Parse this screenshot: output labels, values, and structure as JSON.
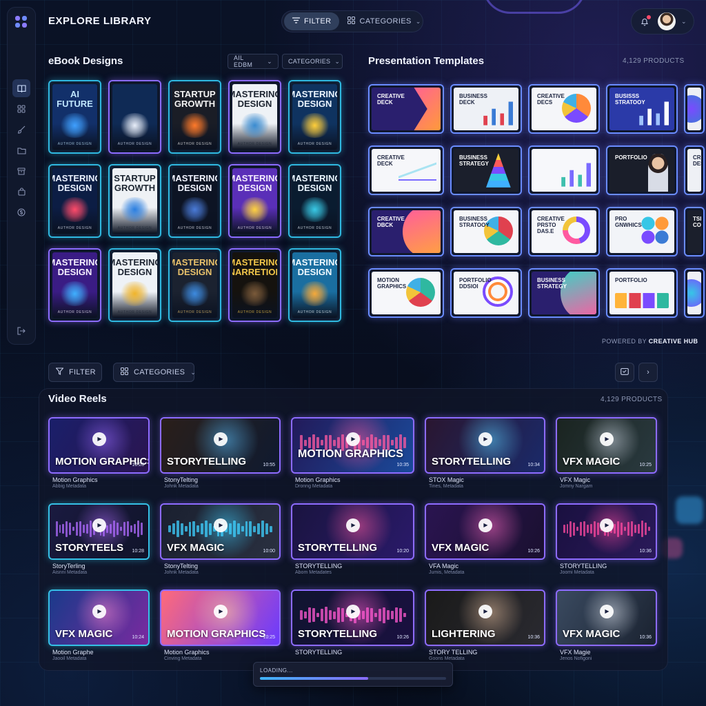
{
  "header": {
    "title": "EXPLORE LIBRARY",
    "filter_label": "FILTER",
    "categories_label": "CATEGORIES"
  },
  "ebooks": {
    "title": "eBook Designs",
    "filter_all": "AIL EDBM",
    "filter_categories": "CATEGORIES",
    "items": [
      {
        "title": "AI FUTURE",
        "author": "AUTHOR DESIGN",
        "bg": "#12306a",
        "fg": "#bfe6ff",
        "art": "#3fa0ff",
        "frame": "cyan"
      },
      {
        "title": "",
        "author": "AUTHOR DESIGN",
        "bg": "#0f2a55",
        "fg": "#dbe8ff",
        "art": "#e8eef9",
        "frame": "purple"
      },
      {
        "title": "STARTUP GROWTH",
        "author": "AUTHOR DESIGN",
        "bg": "#1a1d26",
        "fg": "#f3f3f3",
        "art": "#ff7a2a",
        "frame": "cyan"
      },
      {
        "title": "MASTERING DESIGN",
        "author": "AUTHOR DESIGN",
        "bg": "#eef2f6",
        "fg": "#1c2430",
        "art": "#3a8bd0",
        "frame": "purple"
      },
      {
        "title": "MASTERING DESIGN",
        "author": "AUTHOR DESIGN",
        "bg": "#0f3360",
        "fg": "#eaf4ff",
        "art": "#ffce3a",
        "frame": "cyan"
      },
      {
        "title": "MASTERING DESIGN",
        "author": "AUTHOR DESIGN",
        "bg": "#0c1d44",
        "fg": "#eaf0ff",
        "art": "#ff4b6a",
        "frame": "cyan"
      },
      {
        "title": "STARTUP GROWTH",
        "author": "AUTHOR DESIGN",
        "bg": "#eef1f5",
        "fg": "#1b2430",
        "art": "#2a7ee0",
        "frame": "cyan"
      },
      {
        "title": "MASTERING DESIGN",
        "author": "AUTHOR DESIGN",
        "bg": "#0d1424",
        "fg": "#f2f4ff",
        "art": "#4a7bd8",
        "frame": "cyan"
      },
      {
        "title": "MASTERING DESIGN",
        "author": "AUTHOR DESIGN",
        "bg": "#5a2fb8",
        "fg": "#f4ecff",
        "art": "#ffd23f",
        "frame": "purple"
      },
      {
        "title": "MASTERING DESIGN",
        "author": "AUTHOR DESIGN",
        "bg": "#0a1c30",
        "fg": "#eaf6ff",
        "art": "#39c9e6",
        "frame": "cyan"
      },
      {
        "title": "MASTERING DESIGN",
        "author": "AUTHOR DESIGN",
        "bg": "#3a1c84",
        "fg": "#f5efff",
        "art": "#3fb0ff",
        "frame": "purple"
      },
      {
        "title": "MASTERING DESIGN",
        "author": "AUTHOR DESIGN",
        "bg": "#eef2f7",
        "fg": "#1e2532",
        "art": "#f0b42a",
        "frame": "cyan"
      },
      {
        "title": "MASTERING DESIGN",
        "author": "AUTHOR DESIGN",
        "bg": "#1b2230",
        "fg": "#e8c16b",
        "art": "#3d8be0",
        "frame": "cyan"
      },
      {
        "title": "MASTERING GNARRETIORS",
        "author": "AUTHOR DESIGN",
        "bg": "#15120e",
        "fg": "#f2c64a",
        "art": "#7a5a3a",
        "frame": "purple"
      },
      {
        "title": "MASTERING DESIGN",
        "author": "AUTHOR DESIGN",
        "bg": "#1a6ea0",
        "fg": "#eef9ff",
        "art": "#f6a93a",
        "frame": "cyan"
      }
    ]
  },
  "presentations": {
    "title": "Presentation Templates",
    "count": "4,129 PRODUCTS",
    "items": [
      {
        "label": "CREATIVE DECK",
        "bg": "#2a1f6e",
        "fg": "#ffffff",
        "shape": "chevron",
        "c1": "#ff5aa0",
        "c2": "#ff9a3a"
      },
      {
        "label": "BUSINESS DECK",
        "bg": "#eef1f6",
        "fg": "#1d2540",
        "shape": "bars",
        "c1": "#e0414f",
        "c2": "#3a7bd5"
      },
      {
        "label": "CREATIVE DECS",
        "bg": "#f5f6f9",
        "fg": "#1d2540",
        "shape": "pie",
        "c1": "#ff8a3a",
        "c2": "#7a4bff"
      },
      {
        "label": "BUSISSS STRATOOY",
        "bg": "#2b3aa8",
        "fg": "#ffffff",
        "shape": "bars",
        "c1": "#9fc2ff",
        "c2": "#ffffff"
      },
      {
        "label": "",
        "bg": "#eef0f5",
        "fg": "#1d2540",
        "shape": "circle",
        "c1": "#7a4bff",
        "c2": "#3a7bd5"
      },
      {
        "label": "CREATIVE DECK",
        "bg": "#f6f7fa",
        "fg": "#1d2540",
        "shape": "line",
        "c1": "#7a6bff",
        "c2": "#36c6e6"
      },
      {
        "label": "BUSINESS STRATEGY",
        "bg": "#1b1f2c",
        "fg": "#ffffff",
        "shape": "pyramid",
        "c1": "#ff5a5a",
        "c2": "#3fb0ff"
      },
      {
        "label": "",
        "bg": "#f7f8fb",
        "fg": "#1d2540",
        "shape": "bars",
        "c1": "#3fbfae",
        "c2": "#7a6bff"
      },
      {
        "label": "PORTFOLIO",
        "bg": "#1a1e2a",
        "fg": "#ffffff",
        "shape": "person",
        "c1": "#e9c3a3",
        "c2": "#3a5bd5"
      },
      {
        "label": "CREA DESIG",
        "bg": "#eef0f5",
        "fg": "#1d2540",
        "shape": "none",
        "c1": "#3a7bd5",
        "c2": "#3a7bd5"
      },
      {
        "label": "CREATIVE DBCK",
        "bg": "#2a1f6e",
        "fg": "#ffffff",
        "shape": "swoosh",
        "c1": "#ff5aa0",
        "c2": "#ffa63a"
      },
      {
        "label": "BUSINESS STRATOOY",
        "bg": "#f5f6f9",
        "fg": "#1d2540",
        "shape": "pie",
        "c1": "#e0414f",
        "c2": "#2fb8a0"
      },
      {
        "label": "CREATIVE PRSTO DAS.E",
        "bg": "#f6f7fa",
        "fg": "#1d2540",
        "shape": "donut",
        "c1": "#7a4bff",
        "c2": "#ff5aa0"
      },
      {
        "label": "PRO GNWHICS",
        "bg": "#f2f4f8",
        "fg": "#1d2540",
        "shape": "dots",
        "c1": "#36c6e6",
        "c2": "#ff9a3a"
      },
      {
        "label": "TSISK CORAI",
        "bg": "#1b1f2c",
        "fg": "#ffffff",
        "shape": "none",
        "c1": "#3a7bd5",
        "c2": "#3a7bd5"
      },
      {
        "label": "MOTION GRAPHICS",
        "bg": "#f6f7fa",
        "fg": "#1d2540",
        "shape": "pie",
        "c1": "#2fb8a0",
        "c2": "#e0414f"
      },
      {
        "label": "PORTFOLIO DDSIOI",
        "bg": "#f5f6f9",
        "fg": "#1d2540",
        "shape": "rings",
        "c1": "#7a4bff",
        "c2": "#ff8a3a"
      },
      {
        "label": "BUSINESS STRATEGY",
        "bg": "#2a1f6e",
        "fg": "#ffffff",
        "shape": "swoosh",
        "c1": "#36d6c6",
        "c2": "#ff5aa0"
      },
      {
        "label": "PORTFOLIO",
        "bg": "#f4f5f9",
        "fg": "#1d2540",
        "shape": "cards",
        "c1": "#ffb43a",
        "c2": "#e0414f"
      },
      {
        "label": "",
        "bg": "#eef0f5",
        "fg": "#1d2540",
        "shape": "circle",
        "c1": "#36c6e6",
        "c2": "#7a4bff"
      }
    ]
  },
  "powered": {
    "prefix": "POWERED BY",
    "brand": "CREATIVE HUB"
  },
  "controls": {
    "filter_label": "FILTER",
    "categories_label": "CATEGORIES"
  },
  "videos": {
    "title": "Video Reels",
    "count": "4,129 PRODUCTS",
    "items": [
      {
        "label": "MOTION GRAPHICS",
        "duration": "10:28",
        "title": "Motion Graphics",
        "sub": "Abbig Metadata",
        "bg1": "#1a1f6a",
        "bg2": "#2b1550",
        "accent": "#9a6bff",
        "frame": "purple",
        "wave": false,
        "big": false
      },
      {
        "label": "STORYTELLING",
        "duration": "10:55",
        "title": "StonyTelting",
        "sub": "Johnk Metadata",
        "bg1": "#2a1f1a",
        "bg2": "#0f1a30",
        "accent": "#5ac0ff",
        "frame": "purple",
        "wave": false,
        "big": false
      },
      {
        "label": "MOTION GRAPHICS",
        "duration": "10:35",
        "title": "Motion Graphics",
        "sub": "Dronng Metadata",
        "bg1": "#221a5a",
        "bg2": "#1a4a9a",
        "accent": "#ff5aa0",
        "frame": "purple",
        "wave": true,
        "big": true
      },
      {
        "label": "STORYTELLING",
        "duration": "10:34",
        "title": "STOX Magic",
        "sub": "Tines, Metadata",
        "bg1": "#2a1630",
        "bg2": "#1a2a6a",
        "accent": "#5ad0ff",
        "frame": "purple",
        "wave": false,
        "big": false
      },
      {
        "label": "VFX MAGIC",
        "duration": "10:25",
        "title": "VFX Magic",
        "sub": "Jomny Nargam",
        "bg1": "#1a2420",
        "bg2": "#2a3a40",
        "accent": "#cfd8e6",
        "frame": "purple",
        "wave": false,
        "big": false
      },
      {
        "label": "STORYTEELS",
        "duration": "10:28",
        "title": "StoryTerling",
        "sub": "Aisnni Metadata",
        "bg1": "#1a1a40",
        "bg2": "#10142a",
        "accent": "#b06bff",
        "frame": "cyan",
        "wave": true,
        "big": false
      },
      {
        "label": "VFX MAGIC",
        "duration": "10:00",
        "title": "StonyTelting",
        "sub": "Johnk Metadata",
        "bg1": "#1a2030",
        "bg2": "#2a3040",
        "accent": "#3fd0ff",
        "frame": "purple",
        "wave": true,
        "big": false
      },
      {
        "label": "STORYTELLING",
        "duration": "10:20",
        "title": "STORYTELLING",
        "sub": "Abom Metadates",
        "bg1": "#1a1440",
        "bg2": "#2a1a6a",
        "accent": "#ff5aa0",
        "frame": "purple",
        "wave": false,
        "big": false
      },
      {
        "label": "VFX MAGIC",
        "duration": "10:26",
        "title": "VFA Magic",
        "sub": "Jumis, Metadata",
        "bg1": "#2a1450",
        "bg2": "#1a1030",
        "accent": "#ff6ac0",
        "frame": "purple",
        "wave": false,
        "big": false
      },
      {
        "label": "",
        "duration": "10:36",
        "title": "STORYTELLING",
        "sub": "Joomi Metadata",
        "bg1": "#1a1040",
        "bg2": "#2a1a5a",
        "accent": "#ff4aa0",
        "frame": "purple",
        "wave": true,
        "big": false
      },
      {
        "label": "VFX MAGIC",
        "duration": "10:24",
        "title": "Motion Graphe",
        "sub": "Jaooil Metadata",
        "bg1": "#1a3a8a",
        "bg2": "#7a2aa0",
        "accent": "#ff8ad0",
        "frame": "cyan",
        "wave": false,
        "big": false
      },
      {
        "label": "MOTION GRAPHICS",
        "duration": "10:25",
        "title": "Motion Graphics",
        "sub": "Cinving Metadata",
        "bg1": "#ff6a7a",
        "bg2": "#6a3aff",
        "accent": "#ffd0a0",
        "frame": "purple",
        "wave": false,
        "big": false
      },
      {
        "label": "STORYTELLING",
        "duration": "10:26",
        "title": "STORYTELLING",
        "sub": "",
        "bg1": "#101430",
        "bg2": "#1a1040",
        "accent": "#ff5ad0",
        "frame": "purple",
        "wave": true,
        "big": false
      },
      {
        "label": "LIGHTERING",
        "duration": "10:36",
        "title": "STORY TELLING",
        "sub": "Goons Metadata",
        "bg1": "#1a1a1a",
        "bg2": "#2a2a30",
        "accent": "#e8c0a0",
        "frame": "purple",
        "wave": false,
        "big": false
      },
      {
        "label": "VFX MAGIC",
        "duration": "10:36",
        "title": "VFX Magie",
        "sub": "Jenos Nofigoni",
        "bg1": "#3a4a60",
        "bg2": "#1a2230",
        "accent": "#dfe6f0",
        "frame": "purple",
        "wave": false,
        "big": false
      }
    ]
  },
  "loading": {
    "text": "LOADING...",
    "progress": 0.58
  }
}
